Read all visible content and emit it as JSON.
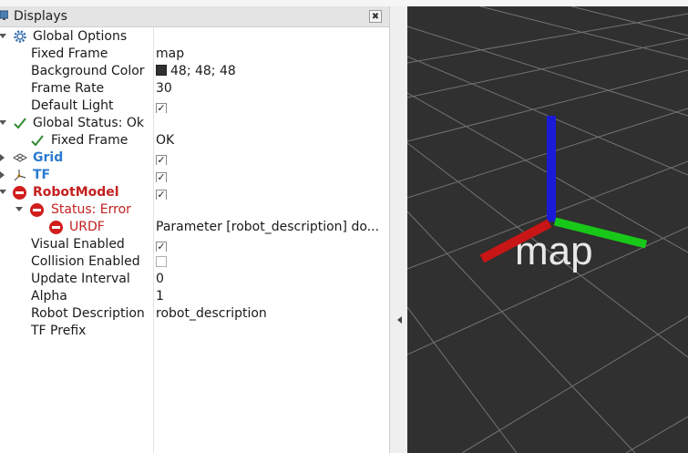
{
  "panel": {
    "title": "Displays",
    "close_label": "✖"
  },
  "rows": {
    "global_options": {
      "label": "Global Options"
    },
    "fixed_frame": {
      "label": "Fixed Frame",
      "value": "map"
    },
    "background_color": {
      "label": "Background Color",
      "value": "48; 48; 48",
      "color": "#303030"
    },
    "frame_rate": {
      "label": "Frame Rate",
      "value": "30"
    },
    "default_light": {
      "label": "Default Light",
      "checked": true
    },
    "global_status": {
      "label": "Global Status: Ok"
    },
    "status_fixed_frame": {
      "label": "Fixed Frame",
      "value": "OK"
    },
    "grid": {
      "label": "Grid",
      "checked": true
    },
    "tf": {
      "label": "TF",
      "checked": true
    },
    "robot_model": {
      "label": "RobotModel",
      "checked": true
    },
    "status_error": {
      "label": "Status: Error"
    },
    "urdf": {
      "label": "URDF",
      "value": "Parameter [robot_description] do..."
    },
    "visual_enabled": {
      "label": "Visual Enabled",
      "checked": true
    },
    "collision_enabled": {
      "label": "Collision Enabled",
      "checked": false
    },
    "update_interval": {
      "label": "Update Interval",
      "value": "0"
    },
    "alpha": {
      "label": "Alpha",
      "value": "1"
    },
    "robot_description": {
      "label": "Robot Description",
      "value": "robot_description"
    },
    "tf_prefix": {
      "label": "TF Prefix"
    }
  },
  "viewport": {
    "frame_label": "map",
    "colors": {
      "background": "#303030",
      "x_axis": "#cc1111",
      "y_axis": "#11cc11",
      "z_axis": "#1111dd",
      "grid": "#8a8a8a"
    }
  },
  "icons": {
    "panel": "monitor-icon",
    "global_options": "gear-icon",
    "global_status": "check-icon",
    "grid": "grid-icon",
    "tf": "tf-axes-icon",
    "error": "stop-icon"
  }
}
